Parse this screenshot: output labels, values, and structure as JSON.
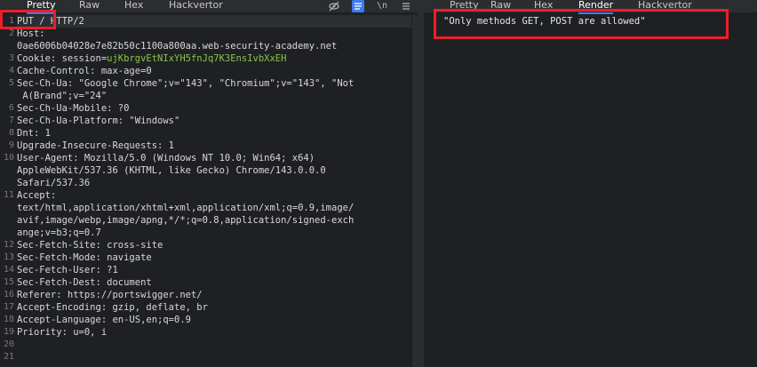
{
  "request": {
    "tabs": [
      {
        "label": "Pretty",
        "active": true
      },
      {
        "label": "Raw",
        "active": false
      },
      {
        "label": "Hex",
        "active": false
      },
      {
        "label": "Hackvertor",
        "active": false
      }
    ],
    "toolbar_icons": [
      "eye-slash-icon",
      "list-icon",
      "newline-icon",
      "menu-icon"
    ],
    "newline_glyph": "\\n",
    "line_numbers": [
      "1",
      "2",
      "",
      "3",
      "4",
      "5",
      "",
      "6",
      "7",
      "8",
      "9",
      "10",
      "",
      "",
      "11",
      "",
      "",
      "",
      "12",
      "13",
      "14",
      "15",
      "16",
      "17",
      "18",
      "19",
      "20",
      "21"
    ],
    "lines": [
      {
        "pre": "PUT / HTTP/2",
        "hl": true
      },
      {
        "pre": "Host:"
      },
      {
        "pre": "0ae6006b04028e7e82b50c1100a800aa.web-security-academy.net"
      },
      {
        "pre": "Cookie: session=",
        "post": "ujKbrgvEtNIxYH5fnJq7K3EnsIvbXxEH"
      },
      {
        "pre": "Cache-Control: max-age=0"
      },
      {
        "pre": "Sec-Ch-Ua: \"Google Chrome\";v=\"143\", \"Chromium\";v=\"143\", \"Not"
      },
      {
        "pre": " A(Brand\";v=\"24\""
      },
      {
        "pre": "Sec-Ch-Ua-Mobile: ?0"
      },
      {
        "pre": "Sec-Ch-Ua-Platform: \"Windows\""
      },
      {
        "pre": "Dnt: 1"
      },
      {
        "pre": "Upgrade-Insecure-Requests: 1"
      },
      {
        "pre": "User-Agent: Mozilla/5.0 (Windows NT 10.0; Win64; x64)"
      },
      {
        "pre": "AppleWebKit/537.36 (KHTML, like Gecko) Chrome/143.0.0.0"
      },
      {
        "pre": "Safari/537.36"
      },
      {
        "pre": "Accept:"
      },
      {
        "pre": "text/html,application/xhtml+xml,application/xml;q=0.9,image/"
      },
      {
        "pre": "avif,image/webp,image/apng,*/*;q=0.8,application/signed-exch"
      },
      {
        "pre": "ange;v=b3;q=0.7"
      },
      {
        "pre": "Sec-Fetch-Site: cross-site"
      },
      {
        "pre": "Sec-Fetch-Mode: navigate"
      },
      {
        "pre": "Sec-Fetch-User: ?1"
      },
      {
        "pre": "Sec-Fetch-Dest: document"
      },
      {
        "pre": "Referer: https://portswigger.net/"
      },
      {
        "pre": "Accept-Encoding: gzip, deflate, br"
      },
      {
        "pre": "Accept-Language: en-US,en;q=0.9"
      },
      {
        "pre": "Priority: u=0, i"
      },
      {
        "pre": ""
      },
      {
        "pre": ""
      }
    ]
  },
  "response": {
    "tabs": [
      {
        "label": "Pretty",
        "active": false
      },
      {
        "label": "Raw",
        "active": false
      },
      {
        "label": "Hex",
        "active": false
      },
      {
        "label": "Render",
        "active": true
      },
      {
        "label": "Hackvertor",
        "active": false
      }
    ],
    "body": "\"Only methods GET, POST are allowed\""
  },
  "colors": {
    "background": "#1f2023",
    "tabbar": "#2b2d31",
    "active_tab_underline": "#3e7bf0",
    "cookie_value": "#8bc34a",
    "annotation_box": "#e8202a"
  }
}
